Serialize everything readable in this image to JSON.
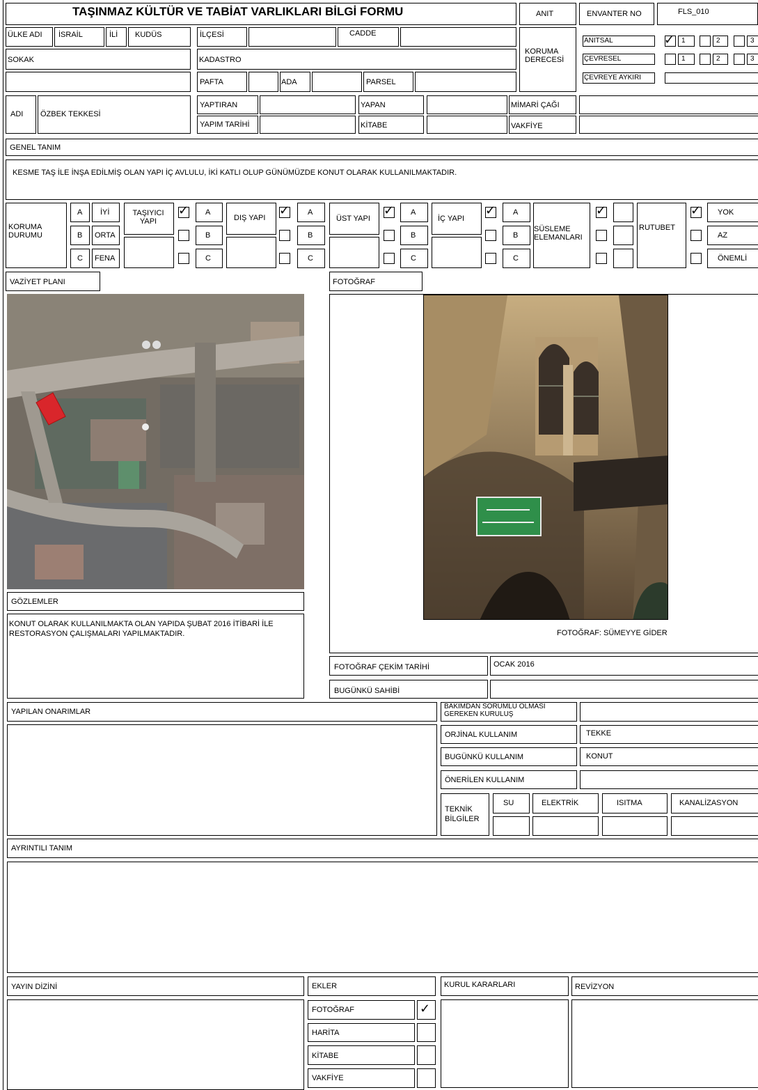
{
  "header": {
    "title": "TAŞINMAZ KÜLTÜR VE TABİAT VARLIKLARI BİLGİ FORMU",
    "anit": "ANIT",
    "envanter_label": "ENVANTER NO",
    "envanter_value": "FLS_010"
  },
  "location": {
    "ulke_label": "ÜLKE ADI",
    "ulke_value": "İSRAİL",
    "il_label": "İLİ",
    "il_value": "KUDÜS",
    "ilce_label": "İLÇESİ",
    "cadde_label": "CADDE",
    "sokak_label": "SOKAK",
    "kadastro_label": "KADASTRO",
    "pafta_label": "PAFTA",
    "ada_label": "ADA",
    "parsel_label": "PARSEL"
  },
  "koruma_derecesi": {
    "label": "KORUMA DERECESİ",
    "anitsal": "ANITSAL",
    "cevresel": "ÇEVRESEL",
    "cevreye_aykiri": "ÇEVREYE AYKIRI",
    "n1": "1",
    "n2": "2",
    "n3": "3"
  },
  "identity": {
    "adi_label": "ADI",
    "adi_value": "ÖZBEK TEKKESİ",
    "yaptiran": "YAPTIRAN",
    "yapim_tarihi": "YAPIM TARİHİ",
    "yapan": "YAPAN",
    "kitabe": "KİTABE",
    "mimari_cagi": "MİMARİ ÇAĞI",
    "vakfiye": "VAKFİYE"
  },
  "genel_tanim": {
    "label": "GENEL TANIM",
    "text": "KESME TAŞ İLE İNŞA EDİLMİŞ OLAN YAPI İÇ AVLULU, İKİ KATLI OLUP GÜNÜMÜZDE KONUT OLARAK KULLANILMAKTADIR."
  },
  "koruma_durumu": {
    "label": "KORUMA DURUMU",
    "a": "A",
    "b": "B",
    "c": "C",
    "iyi": "İYİ",
    "orta": "ORTA",
    "fena": "FENA",
    "tasiyici": "TAŞIYICI YAPI",
    "dis": "DIŞ YAPI",
    "ust": "ÜST YAPI",
    "ic": "İÇ YAPI",
    "susleme": "SÜSLEME ELEMANLARI",
    "rutubet": "RUTUBET",
    "yok": "YOK",
    "az": "AZ",
    "onemli": "ÖNEMLİ"
  },
  "vaziyet": {
    "label": "VAZİYET PLANI"
  },
  "foto": {
    "label": "FOTOĞRAF",
    "credit": "FOTOĞRAF: SÜMEYYE GİDER"
  },
  "gozlemler": {
    "label": "GÖZLEMLER",
    "line1": "KONUT OLARAK KULLANILMAKTA OLAN YAPIDA ŞUBAT 2016 İTİBARİ İLE",
    "line2": "RESTORASYON ÇALIŞMALARI YAPILMAKTADIR."
  },
  "foto_cekim": {
    "label": "FOTOĞRAF ÇEKİM TARİHİ",
    "value": "OCAK 2016"
  },
  "bugunku_sahibi": {
    "label": "BUGÜNKÜ SAHİBİ"
  },
  "onarimlar": {
    "label": "YAPILAN ONARIMLAR"
  },
  "kullanim": {
    "bakim_line1": "BAKIMDAN SORUMLU OLMASI",
    "bakim_line2": "GEREKEN KURULUŞ",
    "orijinal_label": "ORJİNAL KULLANIM",
    "orijinal_value": "TEKKE",
    "bugunku_label": "BUGÜNKÜ KULLANIM",
    "bugunku_value": "KONUT",
    "onerilen_label": "ÖNERİLEN KULLANIM"
  },
  "teknik": {
    "label1": "TEKNİK",
    "label2": "BİLGİLER",
    "su": "SU",
    "elektrik": "ELEKTRİK",
    "isitma": "ISITMA",
    "kanalizasyon": "KANALİZASYON"
  },
  "ayrintili": {
    "label": "AYRINTILI TANIM"
  },
  "bottom": {
    "yayin": "YAYIN DİZİNİ",
    "ekler": "EKLER",
    "kurul": "KURUL KARARLARI",
    "revizyon": "REVİZYON",
    "fotograf": "FOTOĞRAF",
    "harita": "HARİTA",
    "kitabe": "KİTABE",
    "vakfiye": "VAKFİYE"
  },
  "map_labels": {
    "text": ""
  }
}
